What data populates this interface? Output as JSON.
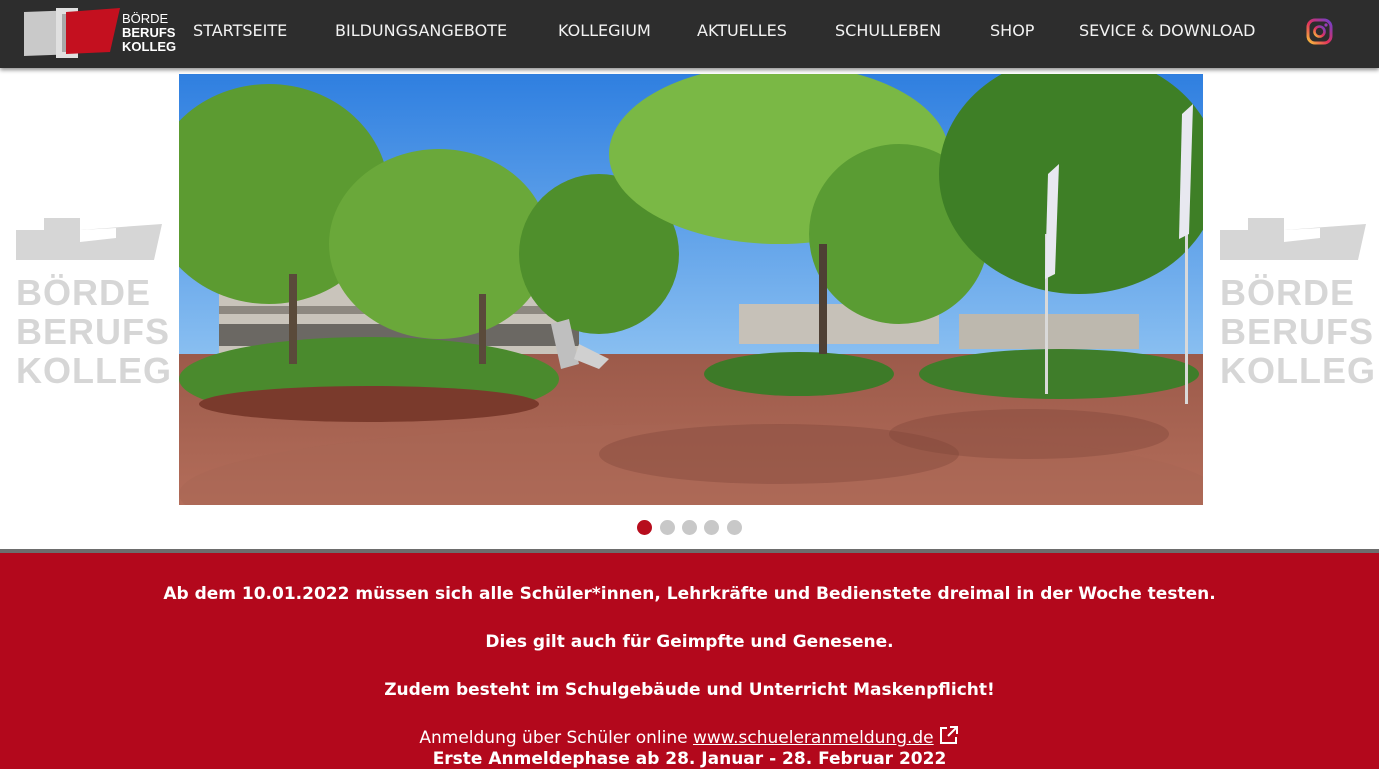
{
  "header": {
    "logo": {
      "line1": "BÖRDE",
      "line2": "BERUFS",
      "line3": "KOLLEG"
    },
    "nav": [
      {
        "label": "STARTSEITE"
      },
      {
        "label": "BILDUNGSANGEBOTE"
      },
      {
        "label": "KOLLEGIUM"
      },
      {
        "label": "AKTUELLES"
      },
      {
        "label": "SCHULLEBEN"
      },
      {
        "label": "SHOP"
      },
      {
        "label": "SEVICE & DOWNLOAD"
      }
    ],
    "social_icon": "instagram-icon"
  },
  "slider": {
    "side_logo": {
      "line1": "BÖRDE",
      "line2": "BERUFS",
      "line3": "KOLLEG"
    },
    "slide_count": 5,
    "active_slide": 1
  },
  "banner": {
    "line1": "Ab dem 10.01.2022 müssen sich alle Schüler*innen, Lehrkräfte und Bedienstete dreimal in der Woche testen.",
    "line2": "Dies gilt auch für Geimpfte und Genesene.",
    "line3": "Zudem besteht im Schulgebäude und Unterricht Maskenpflicht!",
    "registration_prefix": "Anmeldung über Schüler online ",
    "registration_link": "www.schueleranmeldung.de",
    "phase": "Erste Anmeldephase ab 28. Januar - 28. Februar 2022"
  },
  "colors": {
    "header_bg": "#2d2d2d",
    "accent_red": "#b3081c",
    "dot_active": "#b70d1d",
    "dot_inactive": "#c8c8c8"
  }
}
